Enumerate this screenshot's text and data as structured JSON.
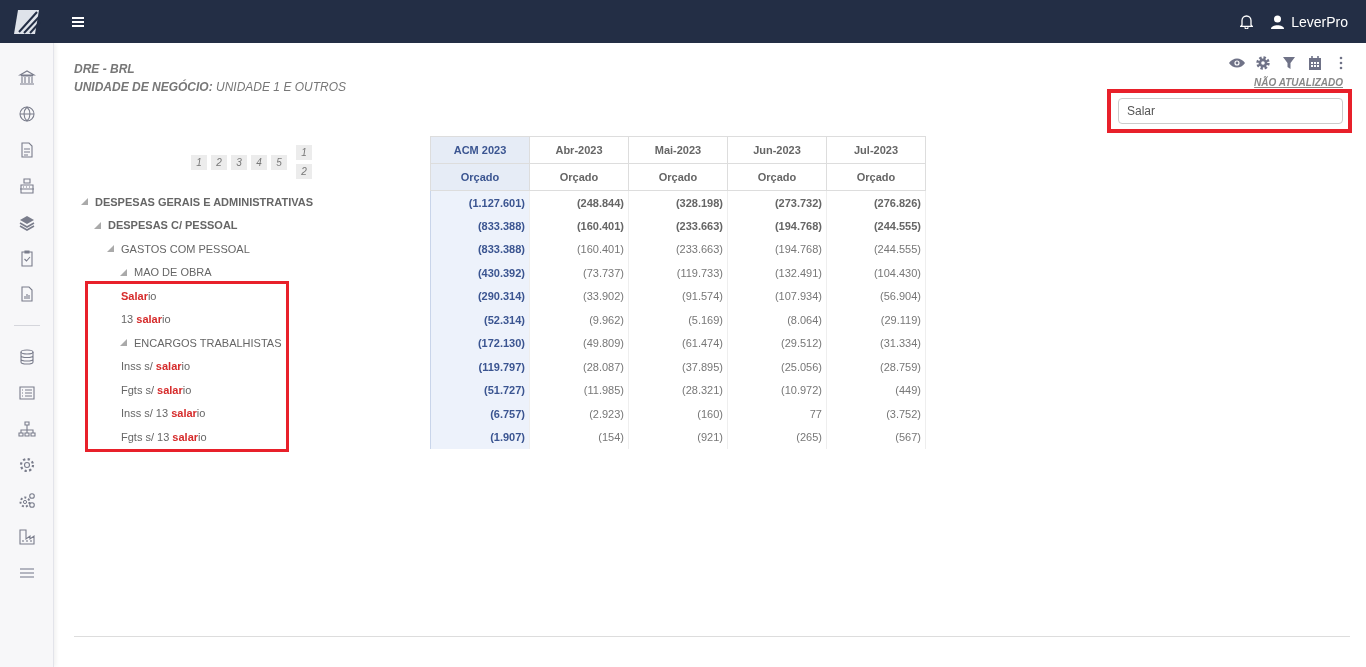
{
  "topbar": {
    "user": "LeverPro"
  },
  "report": {
    "title": "DRE - BRL",
    "unit_label": "UNIDADE DE NEGÓCIO:",
    "unit_value": "UNIDADE 1 E OUTROS",
    "status": "NÃO ATUALIZADO"
  },
  "search": {
    "value": "Salar",
    "highlighted": true
  },
  "levels": {
    "row_levels": [
      "1",
      "2",
      "3",
      "4",
      "5"
    ],
    "column_levels": [
      "1",
      "2"
    ]
  },
  "table": {
    "columns": [
      {
        "label": "ACM 2023",
        "sub": "Orçado",
        "kind": "accumulated"
      },
      {
        "label": "Abr-2023",
        "sub": "Orçado",
        "kind": "month"
      },
      {
        "label": "Mai-2023",
        "sub": "Orçado",
        "kind": "month"
      },
      {
        "label": "Jun-2023",
        "sub": "Orçado",
        "kind": "month"
      },
      {
        "label": "Jul-2023",
        "sub": "Orçado",
        "kind": "month"
      }
    ],
    "rows": [
      {
        "label": "DESPESAS GERAIS E ADMINISTRATIVAS",
        "bold": true,
        "expanded": true,
        "highlighted": false,
        "values": [
          "(1.127.601)",
          "(248.844)",
          "(328.198)",
          "(273.732)",
          "(276.826)"
        ],
        "children": [
          {
            "label": "DESPESAS C/ PESSOAL",
            "bold": true,
            "expanded": true,
            "highlighted": false,
            "values": [
              "(833.388)",
              "(160.401)",
              "(233.663)",
              "(194.768)",
              "(244.555)"
            ],
            "children": [
              {
                "label": "GASTOS COM PESSOAL",
                "bold": false,
                "expanded": true,
                "highlighted": false,
                "values": [
                  "(833.388)",
                  "(160.401)",
                  "(233.663)",
                  "(194.768)",
                  "(244.555)"
                ],
                "children": [
                  {
                    "label": "MAO DE OBRA",
                    "bold": false,
                    "expanded": true,
                    "highlighted": false,
                    "values": [
                      "(430.392)",
                      "(73.737)",
                      "(119.733)",
                      "(132.491)",
                      "(104.430)"
                    ],
                    "children": [
                      {
                        "label": "**Salar**io",
                        "bold": false,
                        "highlighted": true,
                        "values": [
                          "(290.314)",
                          "(33.902)",
                          "(91.574)",
                          "(107.934)",
                          "(56.904)"
                        ]
                      },
                      {
                        "label": "13 **salar**io",
                        "bold": false,
                        "highlighted": true,
                        "values": [
                          "(52.314)",
                          "(9.962)",
                          "(5.169)",
                          "(8.064)",
                          "(29.119)"
                        ]
                      }
                    ]
                  },
                  {
                    "label": "ENCARGOS TRABALHISTAS",
                    "bold": false,
                    "expanded": true,
                    "highlighted": true,
                    "values": [
                      "(172.130)",
                      "(49.809)",
                      "(61.474)",
                      "(29.512)",
                      "(31.334)"
                    ],
                    "children": [
                      {
                        "label": "Inss s/ **salar**io",
                        "bold": false,
                        "highlighted": true,
                        "values": [
                          "(119.797)",
                          "(28.087)",
                          "(37.895)",
                          "(25.056)",
                          "(28.759)"
                        ]
                      },
                      {
                        "label": "Fgts s/ **salar**io",
                        "bold": false,
                        "highlighted": true,
                        "values": [
                          "(51.727)",
                          "(11.985)",
                          "(28.321)",
                          "(10.972)",
                          "(449)"
                        ]
                      },
                      {
                        "label": "Inss s/ 13 **salar**io",
                        "bold": false,
                        "highlighted": true,
                        "values": [
                          "(6.757)",
                          "(2.923)",
                          "(160)",
                          "77",
                          "(3.752)"
                        ]
                      },
                      {
                        "label": "Fgts s/ 13 **salar**io",
                        "bold": false,
                        "highlighted": true,
                        "values": [
                          "(1.907)",
                          "(154)",
                          "(921)",
                          "(265)",
                          "(567)"
                        ]
                      }
                    ]
                  }
                ]
              }
            ]
          }
        ]
      }
    ]
  }
}
